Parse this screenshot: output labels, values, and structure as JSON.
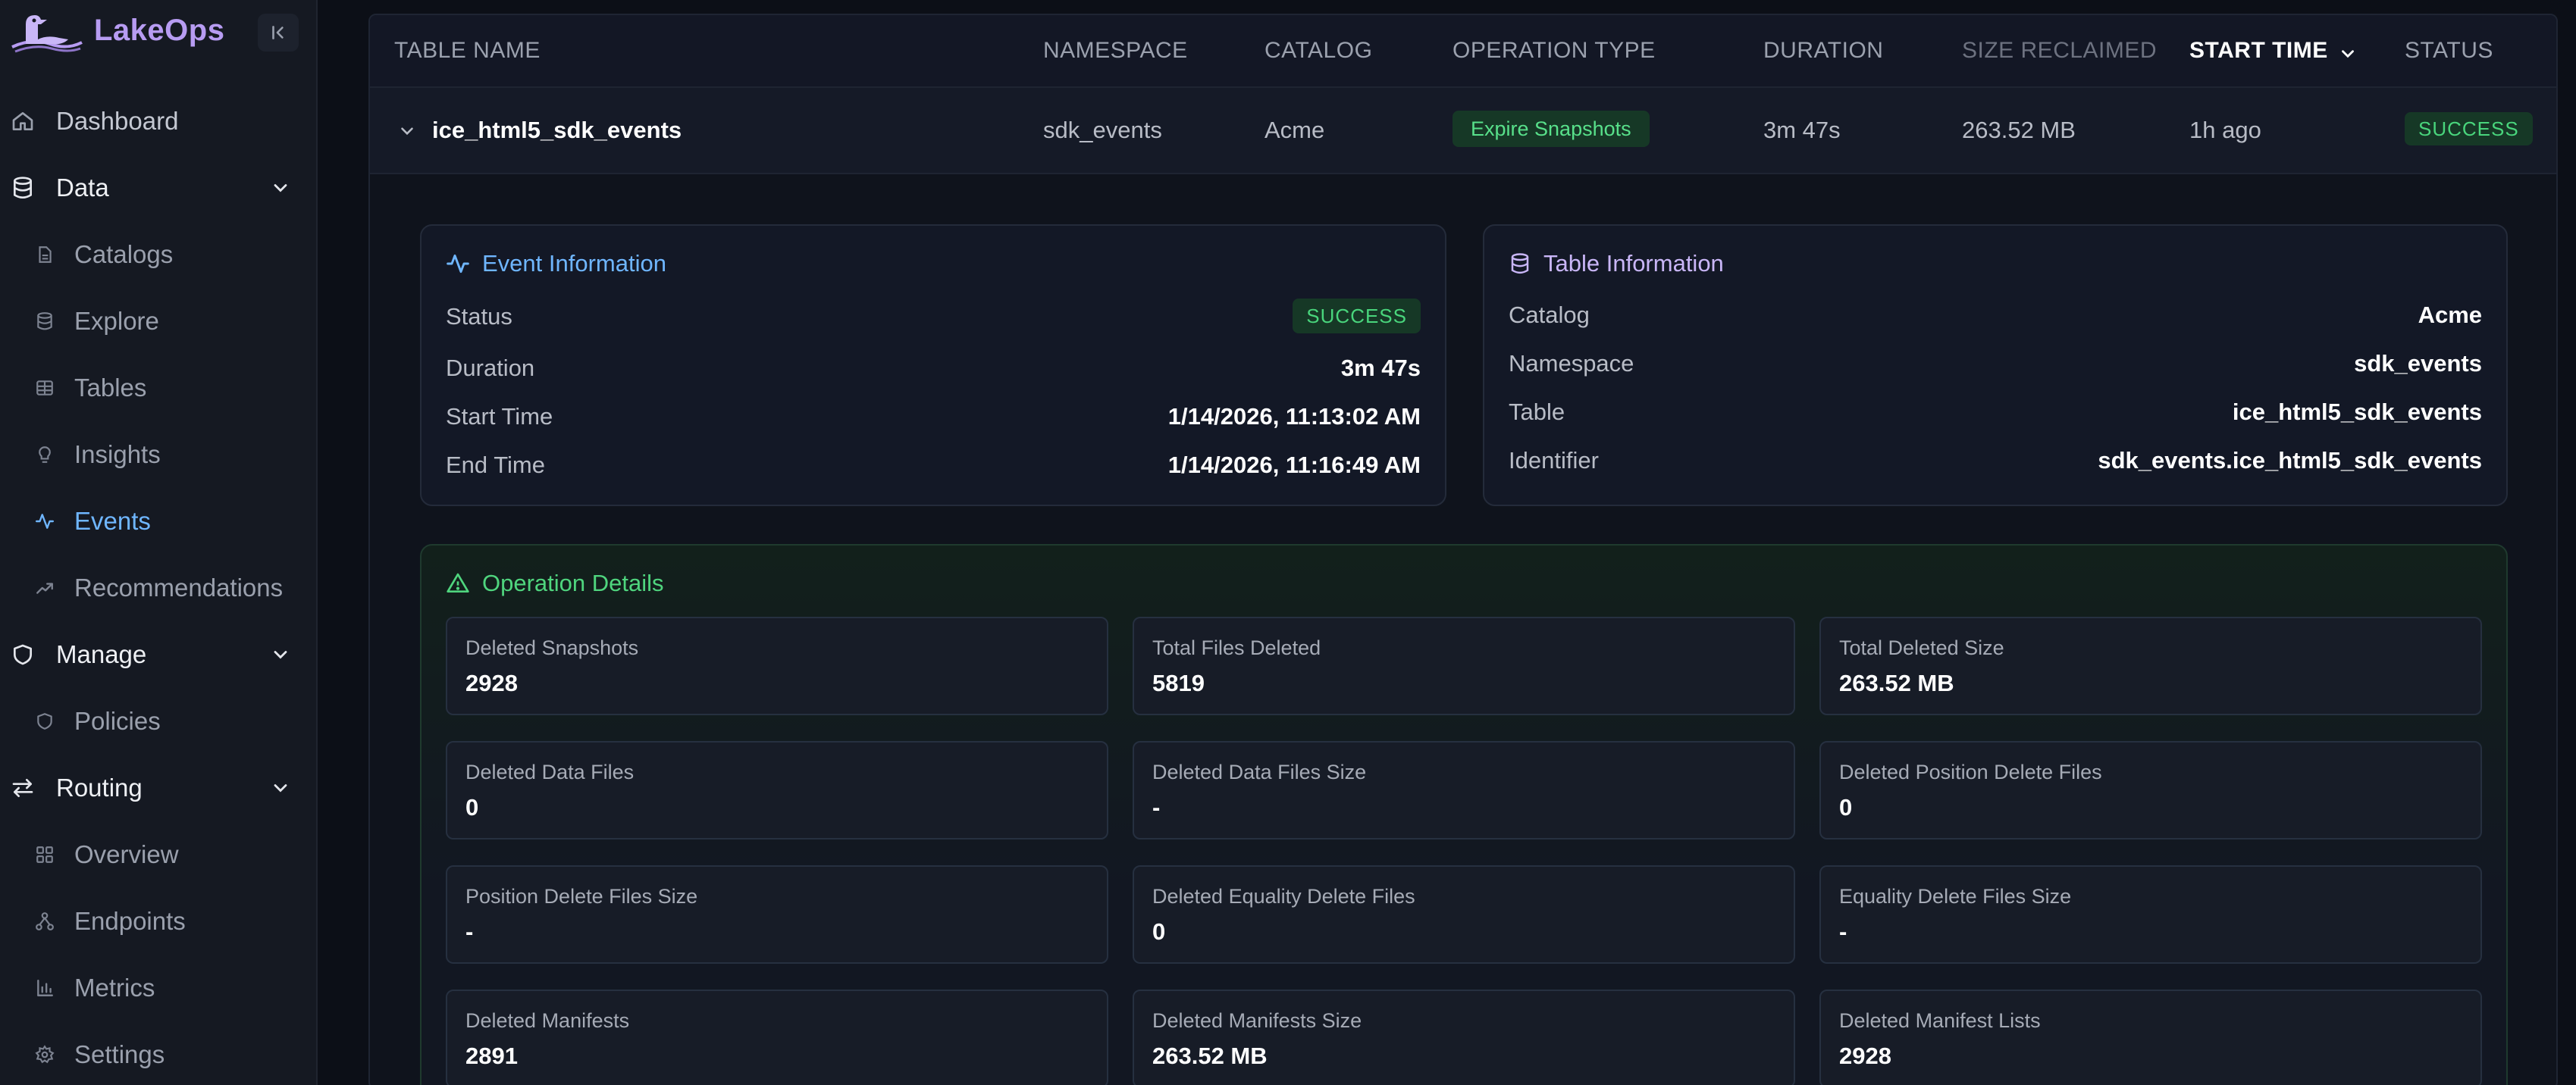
{
  "app": {
    "name": "LakeOps"
  },
  "sidebar": {
    "items": [
      {
        "label": "Dashboard",
        "icon": "home-icon"
      },
      {
        "label": "Data",
        "icon": "database-icon"
      },
      {
        "label": "Catalogs",
        "icon": "file-icon"
      },
      {
        "label": "Explore",
        "icon": "database-icon"
      },
      {
        "label": "Tables",
        "icon": "table-icon"
      },
      {
        "label": "Insights",
        "icon": "lightbulb-icon"
      },
      {
        "label": "Events",
        "icon": "activity-icon"
      },
      {
        "label": "Recommendations",
        "icon": "trending-up-icon"
      },
      {
        "label": "Manage",
        "icon": "shield-icon"
      },
      {
        "label": "Policies",
        "icon": "shield-icon"
      },
      {
        "label": "Routing",
        "icon": "arrows-icon"
      },
      {
        "label": "Overview",
        "icon": "grid-icon"
      },
      {
        "label": "Endpoints",
        "icon": "network-icon"
      },
      {
        "label": "Metrics",
        "icon": "bar-chart-icon"
      },
      {
        "label": "Settings",
        "icon": "gear-icon"
      }
    ],
    "active": "Events"
  },
  "table": {
    "headers": {
      "table_name": "TABLE NAME",
      "namespace": "NAMESPACE",
      "catalog": "CATALOG",
      "operation_type": "OPERATION TYPE",
      "duration": "DURATION",
      "size_reclaimed": "SIZE RECLAIMED",
      "start_time": "START TIME",
      "status": "STATUS"
    },
    "row": {
      "table_name": "ice_html5_sdk_events",
      "namespace": "sdk_events",
      "catalog": "Acme",
      "operation_type": "Expire Snapshots",
      "duration": "3m 47s",
      "size_reclaimed": "263.52 MB",
      "start_time": "1h ago",
      "status": "SUCCESS"
    }
  },
  "event_info": {
    "title": "Event Information",
    "status_label": "Status",
    "status_value": "SUCCESS",
    "duration_label": "Duration",
    "duration_value": "3m 47s",
    "start_label": "Start Time",
    "start_value": "1/14/2026, 11:13:02 AM",
    "end_label": "End Time",
    "end_value": "1/14/2026, 11:16:49 AM"
  },
  "table_info": {
    "title": "Table Information",
    "catalog_label": "Catalog",
    "catalog_value": "Acme",
    "namespace_label": "Namespace",
    "namespace_value": "sdk_events",
    "table_label": "Table",
    "table_value": "ice_html5_sdk_events",
    "identifier_label": "Identifier",
    "identifier_value": "sdk_events.ice_html5_sdk_events"
  },
  "operation_details": {
    "title": "Operation Details",
    "metrics": [
      {
        "label": "Deleted Snapshots",
        "value": "2928"
      },
      {
        "label": "Total Files Deleted",
        "value": "5819"
      },
      {
        "label": "Total Deleted Size",
        "value": "263.52 MB"
      },
      {
        "label": "Deleted Data Files",
        "value": "0"
      },
      {
        "label": "Deleted Data Files Size",
        "value": "-"
      },
      {
        "label": "Deleted Position Delete Files",
        "value": "0"
      },
      {
        "label": "Position Delete Files Size",
        "value": "-"
      },
      {
        "label": "Deleted Equality Delete Files",
        "value": "0"
      },
      {
        "label": "Equality Delete Files Size",
        "value": "-"
      },
      {
        "label": "Deleted Manifests",
        "value": "2891"
      },
      {
        "label": "Deleted Manifests Size",
        "value": "263.52 MB"
      },
      {
        "label": "Deleted Manifest Lists",
        "value": "2928"
      }
    ]
  },
  "colors": {
    "accent_purple": "#b79cf2",
    "active_blue": "#6fb6ff",
    "success_green": "#49d57c",
    "background": "#0c0f17"
  }
}
